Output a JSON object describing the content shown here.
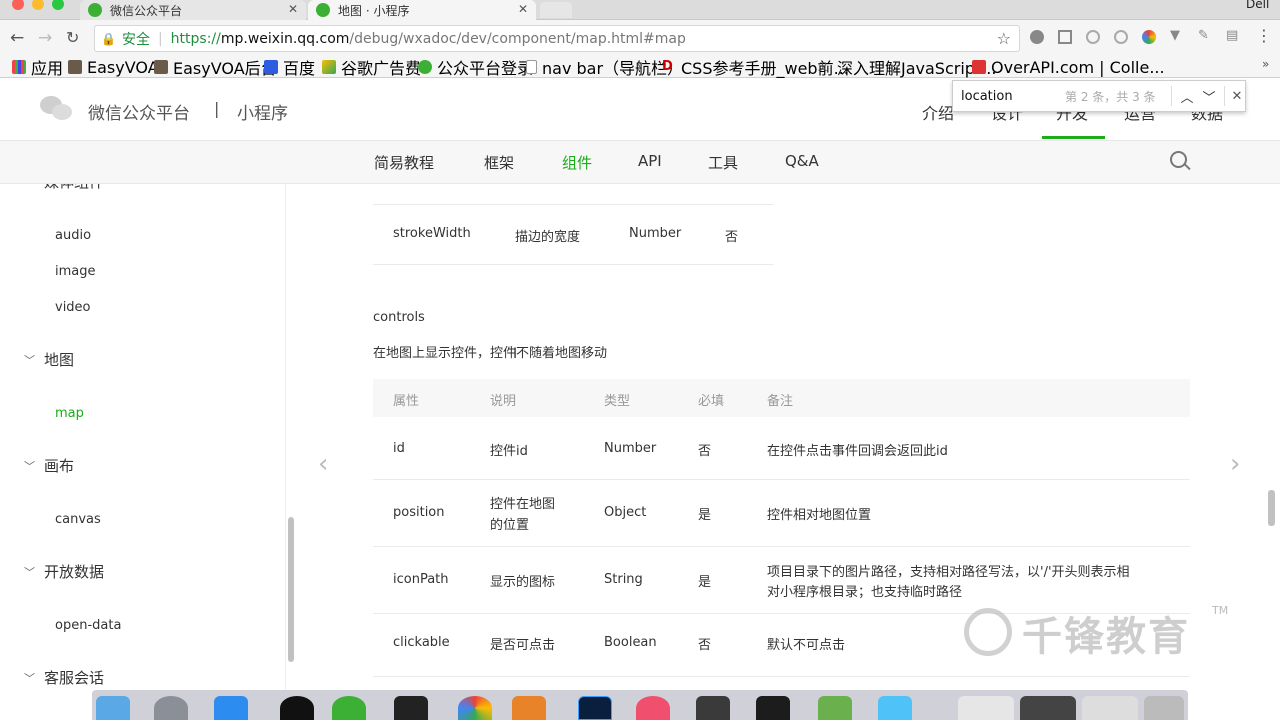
{
  "browser": {
    "tabs": [
      {
        "title": "微信公众平台"
      },
      {
        "title": "地图 · 小程序"
      }
    ],
    "profile": "Dell",
    "secure_label": "安全",
    "url_prefix": "https://",
    "url_host": "mp.weixin.qq.com",
    "url_path": "/debug/wxadoc/dev/component/map.html#map",
    "bookmarks": [
      "应用",
      "EasyVOA",
      "EasyVOA后台",
      "百度",
      "谷歌广告费",
      "公众平台登录",
      "nav bar（导航栏）",
      "CSS参考手册_web前...",
      "深入理解JavaScript...",
      "OverAPI.com | Colle..."
    ],
    "find": {
      "query": "location",
      "status": "第 2 条，共 3 条"
    }
  },
  "header": {
    "logo_text": "微信公众平台",
    "separator": "|",
    "section": "小程序",
    "nav": [
      "介绍",
      "设计",
      "开发",
      "运营",
      "数据"
    ],
    "subnav": [
      "简易教程",
      "框架",
      "组件",
      "API",
      "工具",
      "Q&A"
    ],
    "active_subnav": "组件"
  },
  "sidebar": {
    "top_partial": "媒体组件",
    "groups": [
      {
        "label": "",
        "items": [
          "audio",
          "image",
          "video"
        ]
      },
      {
        "label": "地图",
        "items": [
          "map"
        ]
      },
      {
        "label": "画布",
        "items": [
          "canvas"
        ]
      },
      {
        "label": "开放数据",
        "items": [
          "open-data"
        ]
      },
      {
        "label": "客服会话",
        "items": []
      }
    ],
    "active_item": "map"
  },
  "main": {
    "prev_row": {
      "attr": "strokeWidth",
      "desc": "描边的宽度",
      "type": "Number",
      "required": "否"
    },
    "section_title": "controls",
    "section_desc": "在地图上显示控件，控件不随着地图移动",
    "table": {
      "headers": [
        "属性",
        "说明",
        "类型",
        "必填",
        "备注"
      ],
      "rows": [
        {
          "attr": "id",
          "desc": "控件id",
          "type": "Number",
          "required": "否",
          "note": "在控件点击事件回调会返回此id"
        },
        {
          "attr": "position",
          "desc": "控件在地图的位置",
          "desc_lines": [
            "控件在地图",
            "的位置"
          ],
          "type": "Object",
          "required": "是",
          "note": "控件相对地图位置"
        },
        {
          "attr": "iconPath",
          "desc": "显示的图标",
          "type": "String",
          "required": "是",
          "note_lines": [
            "项目目录下的图片路径，支持相对路径写法，以'/'开头则表示相",
            "对小程序根目录；也支持临时路径"
          ]
        },
        {
          "attr": "clickable",
          "desc": "是否可点击",
          "type": "Boolean",
          "required": "否",
          "note": "默认不可点击"
        }
      ]
    }
  },
  "watermark": {
    "text": "千锋教育",
    "tm": "TM"
  },
  "colors": {
    "accent": "#1aad19",
    "text": "#333333",
    "muted": "#888888"
  }
}
